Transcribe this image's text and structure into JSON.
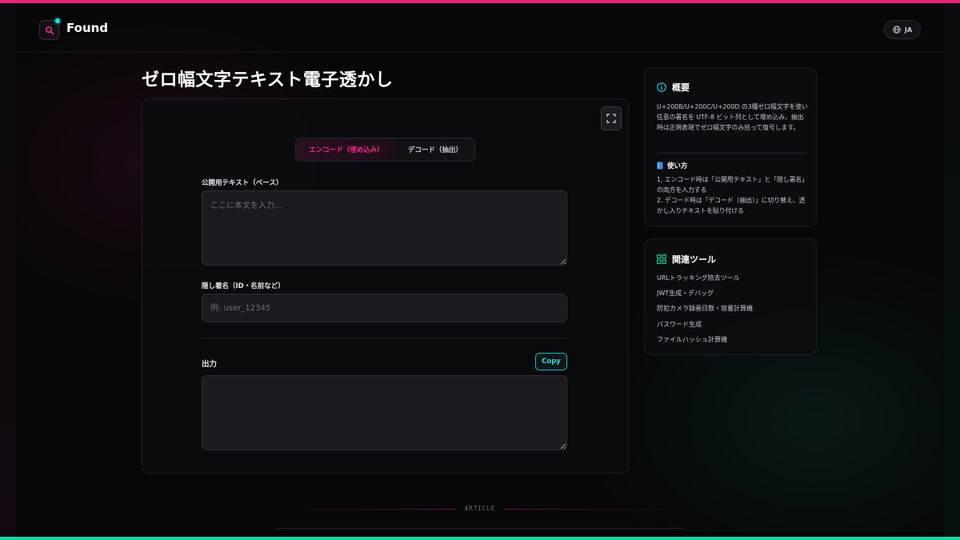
{
  "header": {
    "brand": "Found",
    "lang": "JA"
  },
  "page": {
    "title": "ゼロ幅文字テキスト電子透かし"
  },
  "tool": {
    "tabs": {
      "encode": "エンコード（埋め込み）",
      "decode": "デコード（抽出）"
    },
    "public_text": {
      "label": "公開用テキスト（ベース）",
      "placeholder": "ここに本文を入力...",
      "value": ""
    },
    "signature": {
      "label": "隠し署名（ID・名前など）",
      "placeholder": "例: user_12345",
      "value": ""
    },
    "output": {
      "label": "出力",
      "copy_label": "Copy",
      "value": ""
    }
  },
  "sidebar": {
    "overview": {
      "title": "概要",
      "body": "U+200B/U+200C/U+200D の3種ゼロ幅文字を使い任意の署名を UTF-8 ビット列として埋め込み、抽出時は正規表現でゼロ幅文字のみ拾って復号します。",
      "howto_title": "使い方",
      "steps": [
        "1. エンコード時は「公開用テキスト」と「隠し署名」の両方を入力する",
        "2. デコード時は「デコード（抽出）」に切り替え、透かし入りテキストを貼り付ける"
      ]
    },
    "related": {
      "title": "関連ツール",
      "items": [
        "URLトラッキング除去ツール",
        "JWT生成・デバッグ",
        "防犯カメラ録画日数・容量計算機",
        "パスワード生成",
        "ファイルハッシュ計算機"
      ]
    }
  },
  "footer": {
    "article_label": "ARTICLE"
  },
  "colors": {
    "accent_pink": "#ec1f7a",
    "accent_teal": "#19d8a6",
    "copy_cyan": "#1fb6c0"
  },
  "icons": {
    "logo": "search-icon",
    "lang": "globe-icon",
    "fullscreen": "fullscreen-icon",
    "overview": "info-icon",
    "howto": "book-icon",
    "related": "grid-icon"
  }
}
